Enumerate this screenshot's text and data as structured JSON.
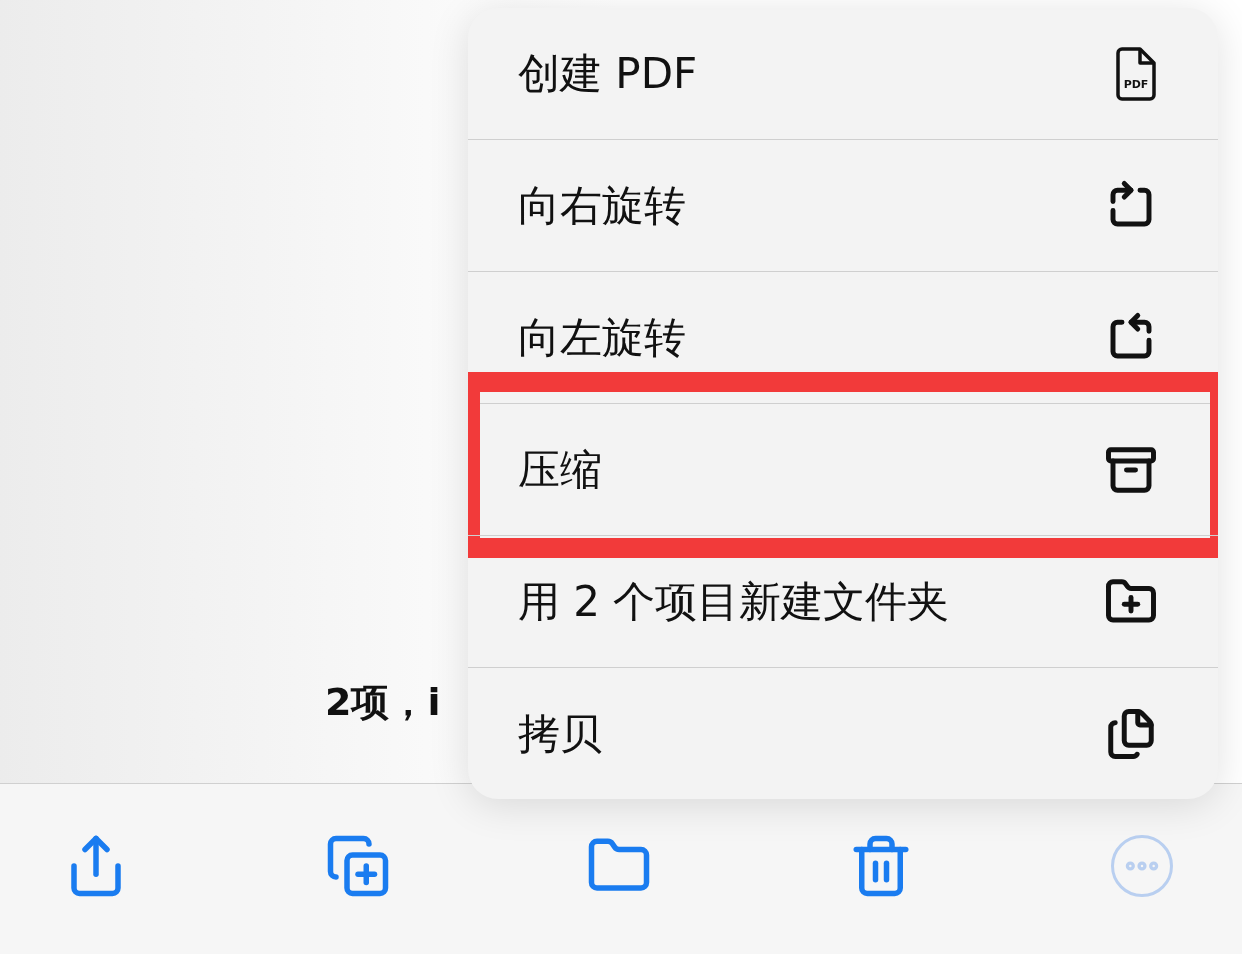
{
  "summary": {
    "text": "2项，i"
  },
  "menu": {
    "items": [
      {
        "label": "创建 PDF",
        "icon_text": "PDF"
      },
      {
        "label": "向右旋转"
      },
      {
        "label": "向左旋转"
      },
      {
        "label": "压缩",
        "highlighted": true
      },
      {
        "label": "用 2 个项目新建文件夹"
      },
      {
        "label": "拷贝"
      }
    ]
  },
  "toolbar": {
    "buttons": [
      {
        "kind": "share",
        "disabled": false
      },
      {
        "kind": "duplicate",
        "disabled": false
      },
      {
        "kind": "move",
        "disabled": false
      },
      {
        "kind": "delete",
        "disabled": false
      },
      {
        "kind": "more",
        "disabled": true
      }
    ]
  }
}
